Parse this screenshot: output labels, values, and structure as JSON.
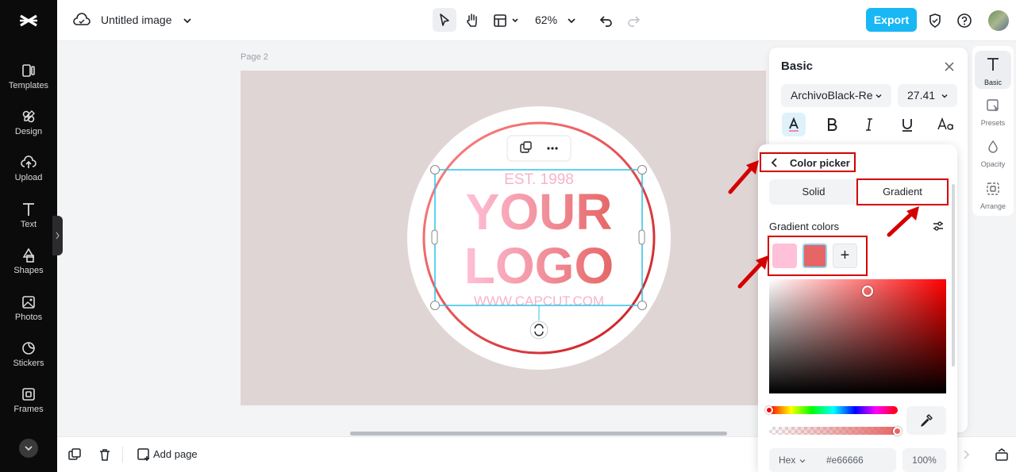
{
  "app": {
    "document_title": "Untitled image",
    "zoom_level": "62%",
    "export_label": "Export"
  },
  "sidebar": {
    "items": [
      {
        "label": "Templates",
        "icon": "templates-icon"
      },
      {
        "label": "Design",
        "icon": "design-icon"
      },
      {
        "label": "Upload",
        "icon": "upload-icon"
      },
      {
        "label": "Text",
        "icon": "text-icon"
      },
      {
        "label": "Shapes",
        "icon": "shapes-icon"
      },
      {
        "label": "Photos",
        "icon": "photos-icon"
      },
      {
        "label": "Stickers",
        "icon": "stickers-icon"
      },
      {
        "label": "Frames",
        "icon": "frames-icon"
      }
    ]
  },
  "canvas": {
    "page_label": "Page 2",
    "logo_est": "EST. 1998",
    "logo_line1": "YOUR",
    "logo_line2": "LOGO",
    "logo_url": "WWW.CAPCUT.COM",
    "background_color": "#e0d5d5"
  },
  "bottom_bar": {
    "add_page_label": "Add page"
  },
  "right_rail": {
    "items": [
      {
        "label": "Basic",
        "icon": "text-basic-icon"
      },
      {
        "label": "Presets",
        "icon": "presets-icon"
      },
      {
        "label": "Opacity",
        "icon": "opacity-icon"
      },
      {
        "label": "Arrange",
        "icon": "arrange-icon"
      }
    ]
  },
  "basic_panel": {
    "title": "Basic",
    "font_family": "ArchivoBlack-Re",
    "font_size": "27.41"
  },
  "color_picker": {
    "title": "Color picker",
    "tab_solid": "Solid",
    "tab_gradient": "Gradient",
    "gradient_colors_label": "Gradient colors",
    "swatch_colors": [
      "#ffc0d9",
      "#e66666"
    ],
    "add_label": "+",
    "hex_mode": "Hex",
    "hex_value": "#e66666",
    "opacity": "100%"
  },
  "colors": {
    "accent": "#19b7f4",
    "annotation_red": "#d40000",
    "selection": "#2ec4e8"
  }
}
